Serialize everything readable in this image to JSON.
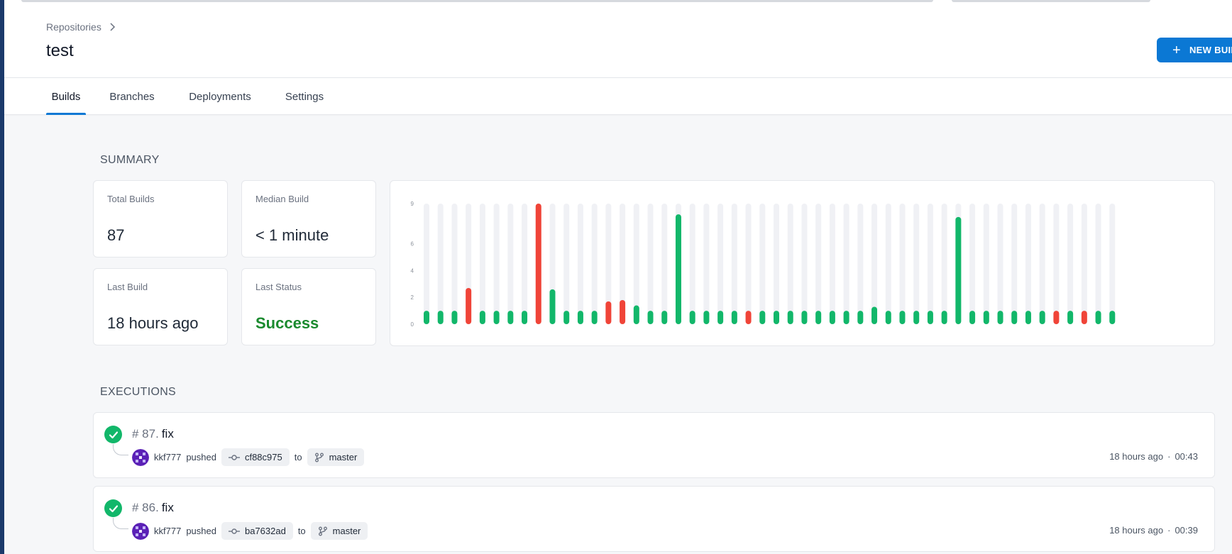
{
  "breadcrumb": {
    "repositories": "Repositories"
  },
  "page": {
    "title": "test"
  },
  "actions": {
    "new_build_label": "NEW BUILD",
    "new_build_icon": "plus-icon"
  },
  "tabs": [
    {
      "label": "Builds",
      "active": true
    },
    {
      "label": "Branches",
      "active": false
    },
    {
      "label": "Deployments",
      "active": false
    },
    {
      "label": "Settings",
      "active": false
    }
  ],
  "summary": {
    "title": "SUMMARY",
    "total_builds": {
      "label": "Total Builds",
      "value": "87"
    },
    "median_build": {
      "label": "Median Build",
      "value": "< 1 minute"
    },
    "last_build": {
      "label": "Last Build",
      "value": "18 hours ago"
    },
    "last_status": {
      "label": "Last Status",
      "value": "Success"
    }
  },
  "colors": {
    "success": "#12b76a",
    "failure": "#f04438",
    "track": "#f0f1f5",
    "accent": "#0b78d4"
  },
  "chart_data": {
    "type": "bar",
    "y_ticks": [
      "0",
      "2",
      "4",
      "6",
      "9"
    ],
    "ylim": [
      0,
      9
    ],
    "values": [
      1,
      1,
      1,
      2.7,
      1,
      1,
      1,
      1,
      9,
      2.6,
      1,
      1,
      1,
      1.7,
      1.8,
      1.4,
      1,
      1,
      8.2,
      1,
      1,
      1,
      1,
      1,
      1,
      1,
      1,
      1,
      1,
      1,
      1,
      1,
      1.3,
      1,
      1,
      1,
      1,
      1,
      8,
      1,
      1,
      1,
      1,
      1,
      1,
      1,
      1,
      1,
      1,
      1
    ],
    "status": [
      "s",
      "s",
      "s",
      "f",
      "s",
      "s",
      "s",
      "s",
      "f",
      "s",
      "s",
      "s",
      "s",
      "f",
      "f",
      "s",
      "s",
      "s",
      "s",
      "s",
      "s",
      "s",
      "s",
      "f",
      "s",
      "s",
      "s",
      "s",
      "s",
      "s",
      "s",
      "s",
      "s",
      "s",
      "s",
      "s",
      "s",
      "s",
      "s",
      "s",
      "s",
      "s",
      "s",
      "s",
      "s",
      "f",
      "s",
      "f",
      "s",
      "s"
    ]
  },
  "executions": {
    "title": "EXECUTIONS",
    "items": [
      {
        "num": "# 87.",
        "message": "fix",
        "author": "kkf777",
        "action": "pushed",
        "commit": "cf88c975",
        "to": "to",
        "branch": "master",
        "when": "18 hours ago",
        "sep": "·",
        "duration": "00:43"
      },
      {
        "num": "# 86.",
        "message": "fix",
        "author": "kkf777",
        "action": "pushed",
        "commit": "ba7632ad",
        "to": "to",
        "branch": "master",
        "when": "18 hours ago",
        "sep": "·",
        "duration": "00:39"
      }
    ]
  }
}
